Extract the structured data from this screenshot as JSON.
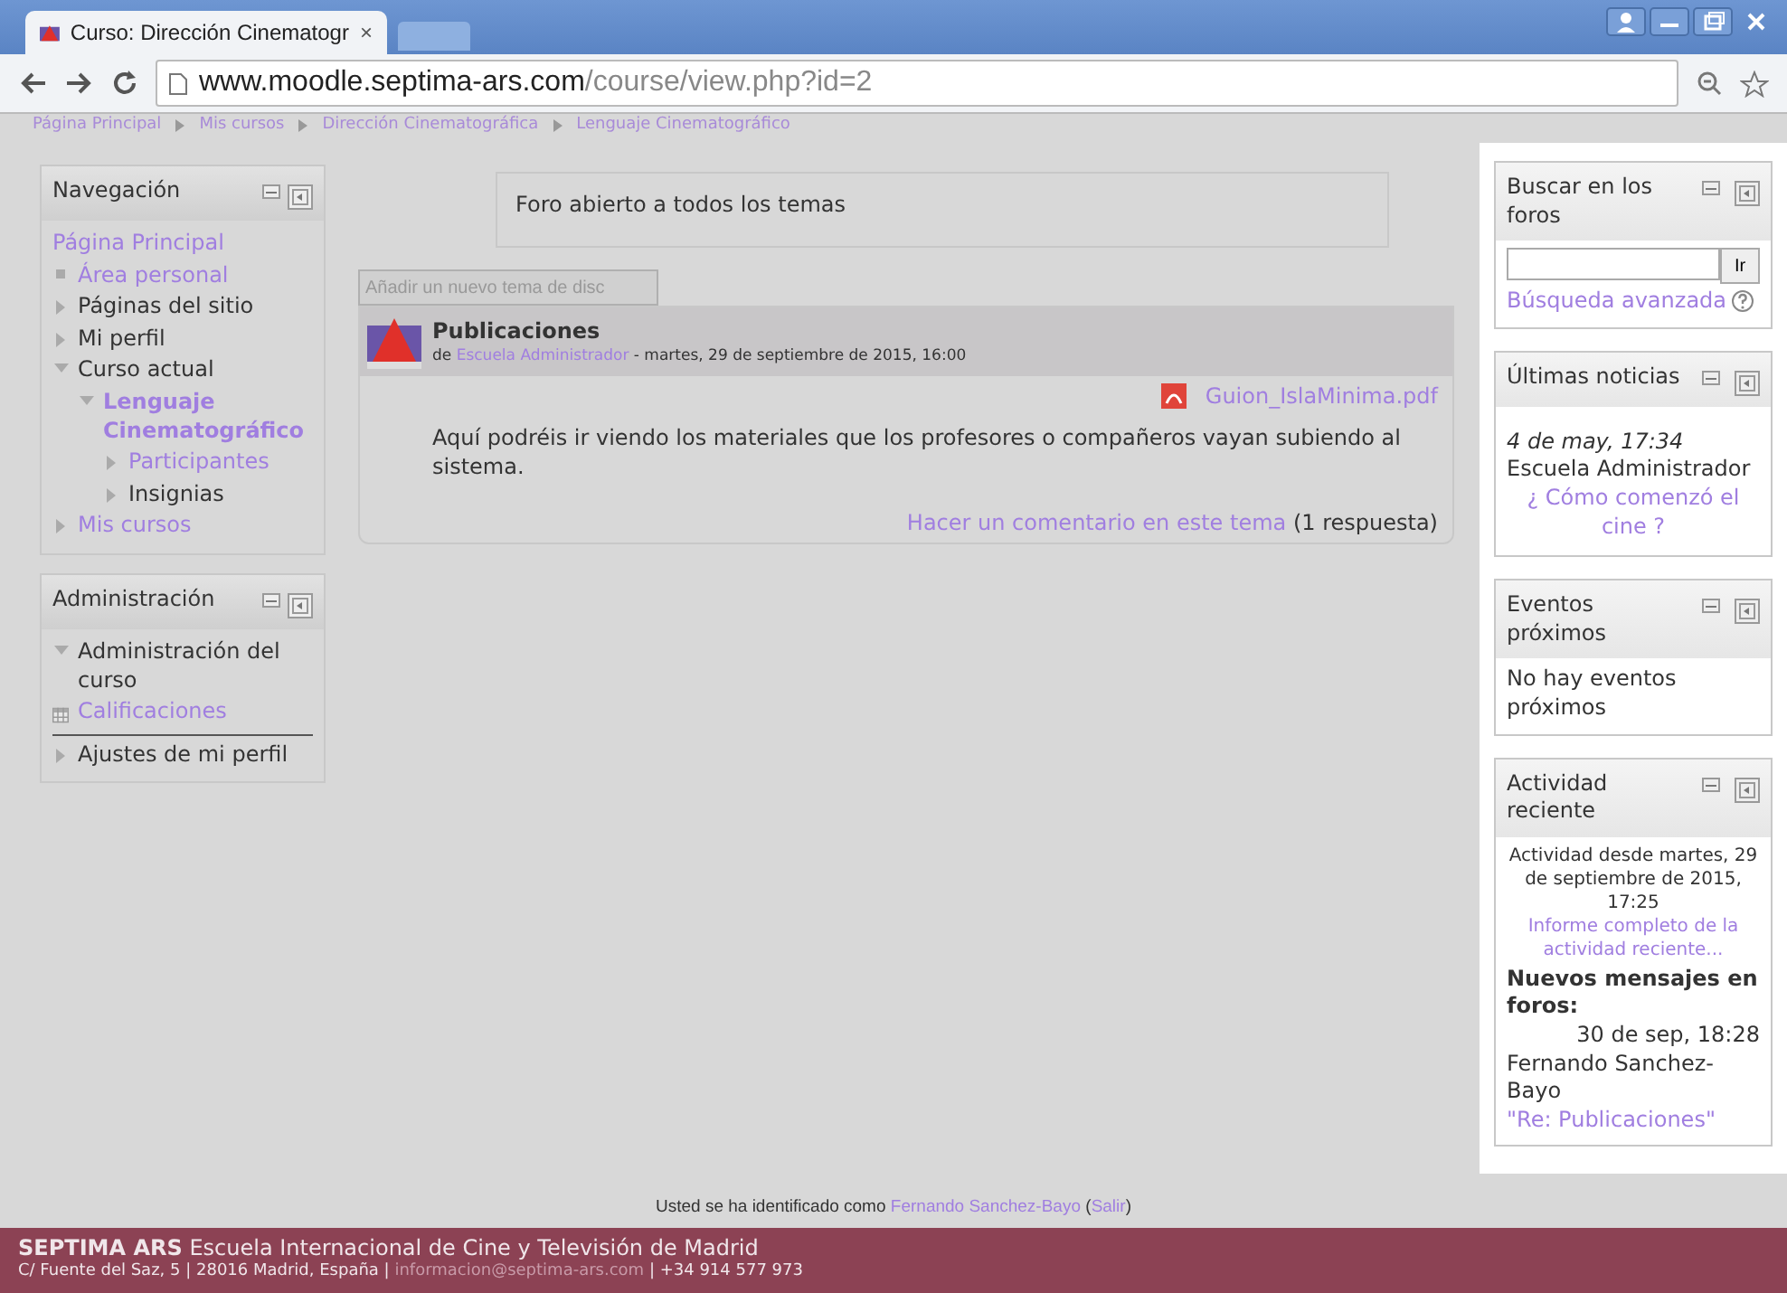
{
  "browser": {
    "tab": {
      "title": "Curso: Dirección Cinematogr",
      "close": "×"
    },
    "url": {
      "host": "www.moodle.septima-ars.com",
      "path": "/course/view.php?id=2"
    }
  },
  "breadcrumb": [
    "Página Principal",
    "Mis cursos",
    "Dirección Cinematográfica",
    "Lenguaje Cinematográfico"
  ],
  "navigation": {
    "title": "Navegación",
    "items": [
      {
        "label": "Página Principal",
        "kind": "root",
        "link": true
      },
      {
        "label": "Área personal",
        "kind": "leaf",
        "link": true
      },
      {
        "label": "Páginas del sitio",
        "kind": "branch",
        "link": false,
        "expanded": false
      },
      {
        "label": "Mi perfil",
        "kind": "branch",
        "link": false,
        "expanded": false
      },
      {
        "label": "Curso actual",
        "kind": "branch",
        "link": false,
        "expanded": true,
        "children": [
          {
            "label": "Lenguaje Cinematográfico",
            "kind": "current",
            "link": true,
            "expanded": true,
            "children": [
              {
                "label": "Participantes",
                "kind": "branch",
                "link": true,
                "expanded": false
              },
              {
                "label": "Insignias",
                "kind": "branch",
                "link": false,
                "expanded": false
              }
            ]
          }
        ]
      },
      {
        "label": "Mis cursos",
        "kind": "branch",
        "link": true,
        "expanded": false
      }
    ]
  },
  "administration": {
    "title": "Administración",
    "items": [
      {
        "label": "Administración del curso",
        "kind": "branch",
        "link": false,
        "expanded": true,
        "children": [
          {
            "label": "Calificaciones",
            "kind": "grades",
            "link": true
          }
        ]
      },
      {
        "label": "Ajustes de mi perfil",
        "kind": "branch",
        "link": false,
        "expanded": false
      }
    ]
  },
  "forum": {
    "intro": "Foro abierto a todos los temas",
    "add_button": "Añadir un nuevo tema de disc",
    "post": {
      "title": "Publicaciones",
      "by": "de",
      "author": "Escuela Administrador",
      "date": "- martes, 29 de septiembre de 2015, 16:00",
      "attachment": "Guion_IslaMinima.pdf",
      "body": "Aquí podréis ir viendo los materiales que los profesores o compañeros vayan subiendo al sistema.",
      "reply_link": "Hacer un comentario en este tema",
      "replies": "(1 respuesta)"
    }
  },
  "search_block": {
    "title": "Buscar en los foros",
    "button": "Ir",
    "advanced": "Búsqueda avanzada"
  },
  "news_block": {
    "title": "Últimas noticias",
    "date": "4 de may, 17:34",
    "author": "Escuela Administrador",
    "link": "¿ Cómo comenzó el cine ?"
  },
  "events_block": {
    "title": "Eventos próximos",
    "text": "No hay eventos próximos"
  },
  "activity_block": {
    "title": "Actividad reciente",
    "since": "Actividad desde martes, 29 de septiembre de 2015, 17:25",
    "report": "Informe completo de la actividad reciente...",
    "heading": "Nuevos mensajes en foros:",
    "date": "30 de sep, 18:28",
    "author": "Fernando Sanchez-Bayo",
    "subject": "\"Re: Publicaciones\""
  },
  "login": {
    "text": "Usted se ha identificado como",
    "user": "Fernando Sanchez-Bayo",
    "open": "(",
    "logout": "Salir",
    "close": ")"
  },
  "footer": {
    "brand": "SEPTIMA ARS",
    "name": "Escuela Internacional de Cine y Televisión de Madrid",
    "address": "C/ Fuente del Saz, 5 | 28016 Madrid, España |",
    "email": "informacion@septima-ars.com",
    "phone": "| +34 914 577 973"
  }
}
